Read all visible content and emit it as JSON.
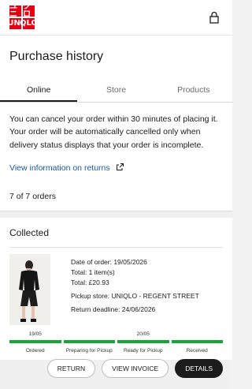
{
  "header": {
    "logo_chars": [
      "ユ",
      "ニ",
      "ク",
      "ロ",
      "U",
      "N",
      "I",
      "Q",
      "L",
      "O"
    ],
    "logo_top": [
      "ユニ",
      "クロ"
    ],
    "logo_bottom": [
      "UNI",
      "QLO"
    ],
    "brand_color": "#e60012",
    "account_icon": "lock-icon"
  },
  "page": {
    "title": "Purchase history"
  },
  "tabs": [
    {
      "label": "Online",
      "active": true
    },
    {
      "label": "Store",
      "active": false
    },
    {
      "label": "Products",
      "active": false
    }
  ],
  "info": {
    "message": "You can cancel your order within 30 minutes of placing it. Your order will be automatically cancelled only when delivery status displays that your order is incomplete.",
    "link_label": "View information on returns",
    "link_icon": "external-link-icon",
    "link_color": "#1a56a8"
  },
  "orders": {
    "count_label": "7 of 7 orders",
    "items": [
      {
        "status": "Collected",
        "date_of_order": "Date of order: 19/05/2026",
        "total_items": "Total: 1 item(s)",
        "total_price": "Total: £20.93",
        "pickup_store": "Pickup store: UNIQLO - REGENT STREET",
        "return_deadline": "Return deadline: 24/06/2026",
        "progress": [
          {
            "date": "19/05",
            "label": "Ordered"
          },
          {
            "date": "",
            "label": "Preparing for Pickup"
          },
          {
            "date": "20/05",
            "label": "Ready for Pickup"
          },
          {
            "date": "",
            "label": "Received"
          }
        ],
        "progress_color": "#1aa337",
        "actions": {
          "return": "RETURN",
          "invoice": "VIEW INVOICE",
          "details": "DETAILS"
        }
      }
    ]
  }
}
